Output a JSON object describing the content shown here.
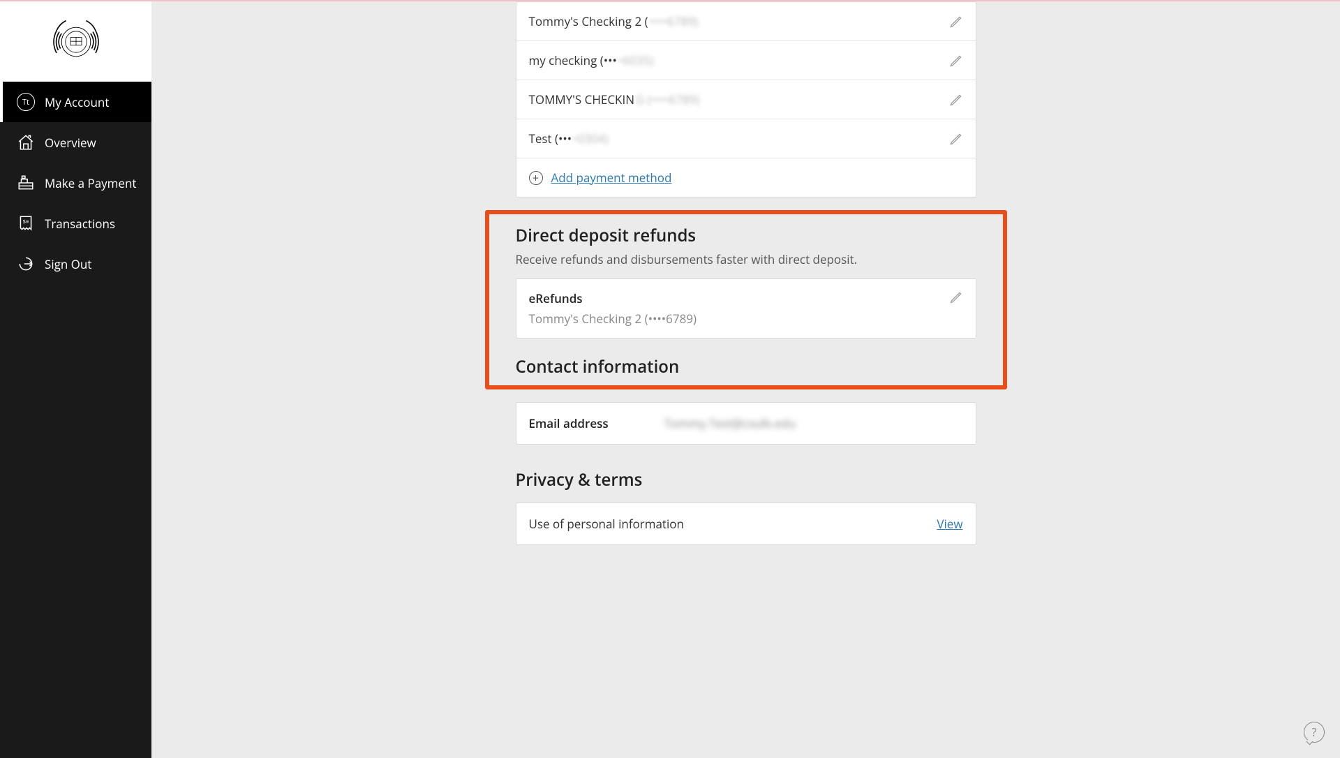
{
  "sidebar": {
    "avatar_initials": "Tt",
    "items": [
      {
        "label": "My Account"
      },
      {
        "label": "Overview"
      },
      {
        "label": "Make a Payment"
      },
      {
        "label": "Transactions"
      },
      {
        "label": "Sign Out"
      }
    ]
  },
  "payment_methods": [
    {
      "name": "Tommy's Checking 2 (",
      "mask": "••••6789)"
    },
    {
      "name": "my checking (•••",
      "mask": "•6035)"
    },
    {
      "name": "TOMMY'S CHECKIN",
      "mask": "G (••••6789)"
    },
    {
      "name": "Test (•••",
      "mask": "•0304)"
    }
  ],
  "add_payment_label": "Add payment method",
  "direct_deposit": {
    "title": "Direct deposit refunds",
    "subtitle": "Receive refunds and disbursements faster with direct deposit.",
    "card_title": "eRefunds",
    "card_account": "Tommy's Checking 2 (••••6789)"
  },
  "contact": {
    "title": "Contact information",
    "email_label": "Email address",
    "email_value": "Tommy.Test@csulb.edu"
  },
  "privacy": {
    "title": "Privacy & terms",
    "row_label": "Use of personal information",
    "view_label": "View"
  },
  "help_glyph": "?"
}
